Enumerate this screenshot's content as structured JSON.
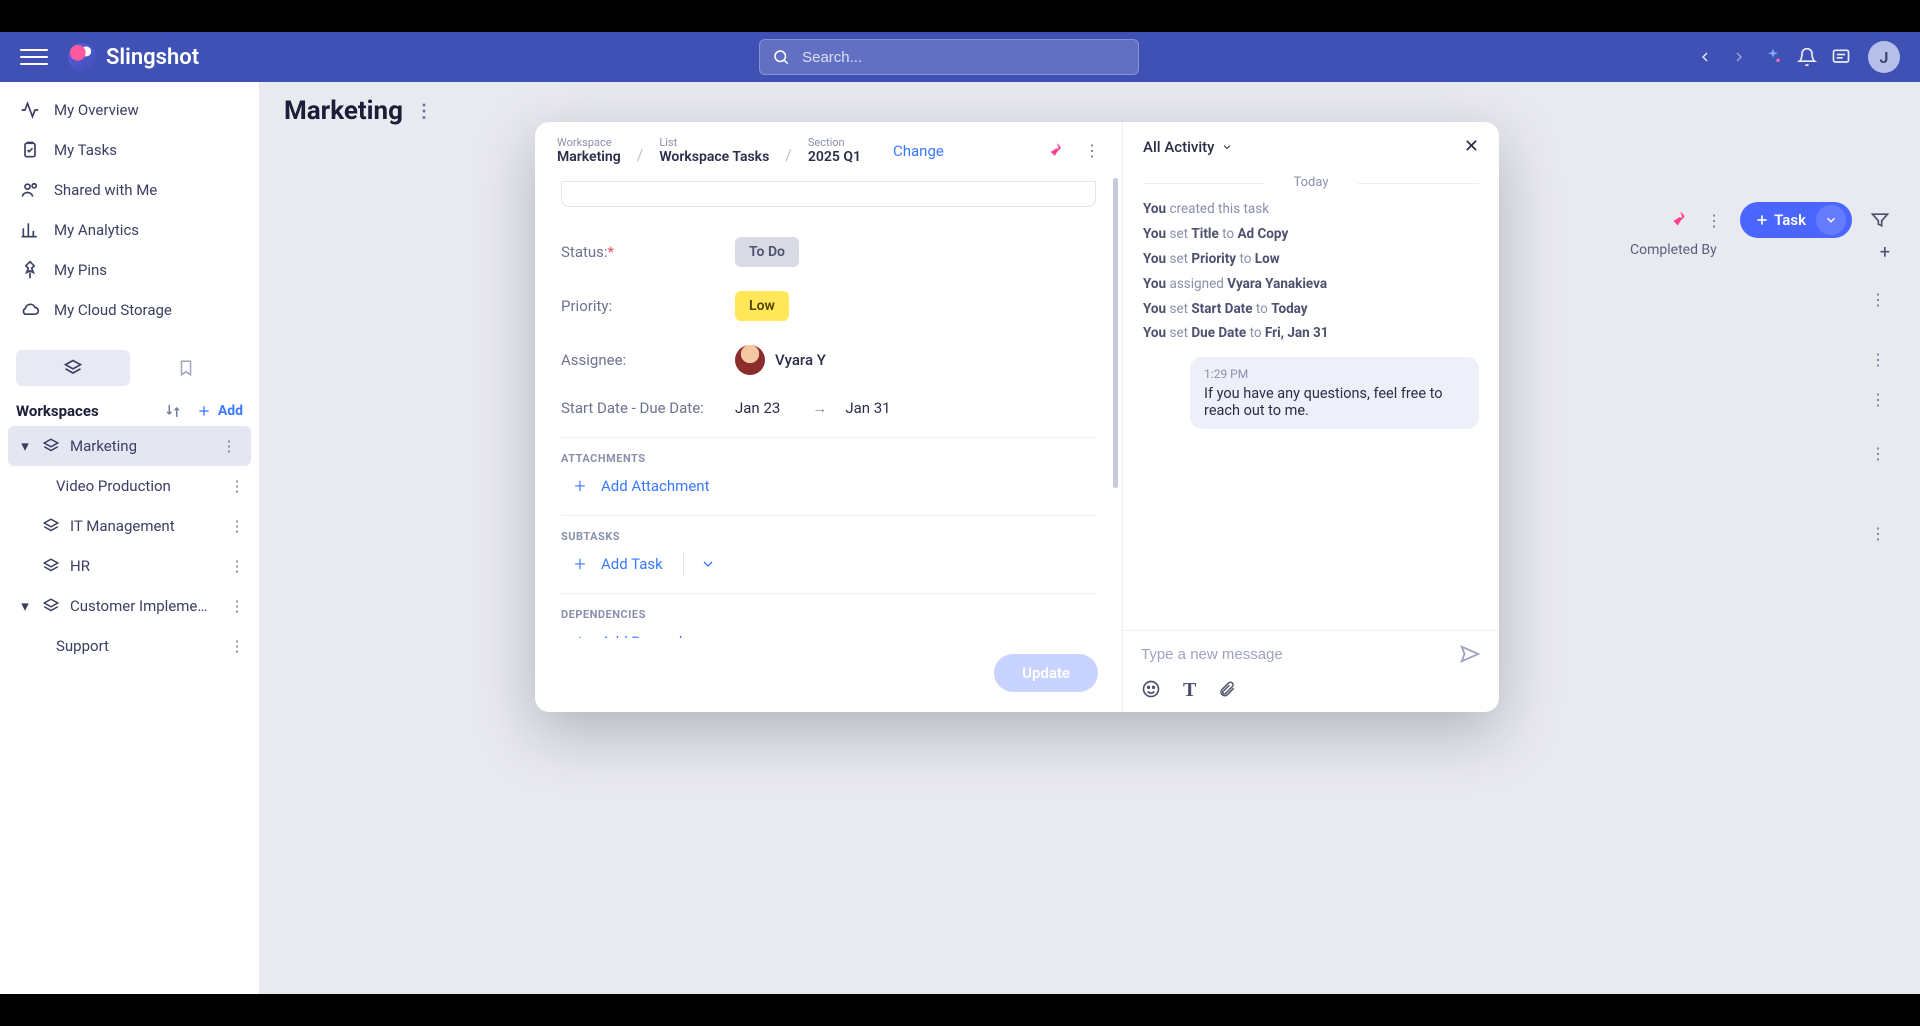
{
  "appbar": {
    "brand": "Slingshot",
    "search_placeholder": "Search...",
    "avatar_initial": "J"
  },
  "sidebar": {
    "items": [
      {
        "label": "My Overview"
      },
      {
        "label": "My Tasks"
      },
      {
        "label": "Shared with Me"
      },
      {
        "label": "My Analytics"
      },
      {
        "label": "My Pins"
      },
      {
        "label": "My Cloud Storage"
      }
    ],
    "workspaces_header": "Workspaces",
    "add_label": "Add",
    "workspaces": [
      {
        "label": "Marketing",
        "active": true,
        "children": [
          {
            "label": "Video Production"
          }
        ]
      },
      {
        "label": "IT Management"
      },
      {
        "label": "HR"
      },
      {
        "label": "Customer Implementa…",
        "children": [
          {
            "label": "Support"
          }
        ]
      }
    ]
  },
  "page": {
    "title": "Marketing",
    "table_col": "Completed By",
    "task_button": "Task"
  },
  "modal": {
    "breadcrumbs": {
      "workspace_label": "Workspace",
      "workspace_value": "Marketing",
      "list_label": "List",
      "list_value": "Workspace Tasks",
      "section_label": "Section",
      "section_value": "2025 Q1",
      "change": "Change"
    },
    "fields": {
      "status_label": "Status:",
      "status_value": "To Do",
      "priority_label": "Priority:",
      "priority_value": "Low",
      "assignee_label": "Assignee:",
      "assignee_value": "Vyara Y",
      "dates_label": "Start Date - Due Date:",
      "start_date": "Jan 23",
      "due_date": "Jan 31"
    },
    "sections": {
      "attachments": "ATTACHMENTS",
      "add_attachment": "Add Attachment",
      "subtasks": "SUBTASKS",
      "add_task": "Add Task",
      "dependencies": "DEPENDENCIES",
      "add_dependency": "Add Dependency"
    },
    "update_button": "Update"
  },
  "activity": {
    "dropdown_label": "All Activity",
    "date_label": "Today",
    "lines": [
      {
        "actor": "You",
        "rest1": " created this task"
      },
      {
        "actor": "You",
        "rest1": " set ",
        "bold1": "Title",
        "rest2": " to ",
        "bold2": "Ad Copy"
      },
      {
        "actor": "You",
        "rest1": " set ",
        "bold1": "Priority",
        "rest2": " to ",
        "bold2": "Low"
      },
      {
        "actor": "You",
        "rest1": " assigned ",
        "bold1": "Vyara Yanakieva"
      },
      {
        "actor": "You",
        "rest1": " set ",
        "bold1": "Start Date",
        "rest2": " to ",
        "bold2": "Today"
      },
      {
        "actor": "You",
        "rest1": " set ",
        "bold1": "Due Date",
        "rest2": " to ",
        "bold2": "Fri, Jan 31"
      }
    ],
    "message_time": "1:29 PM",
    "message_body": "If you have any questions, feel free to reach out to me.",
    "compose_placeholder": "Type a new message"
  }
}
